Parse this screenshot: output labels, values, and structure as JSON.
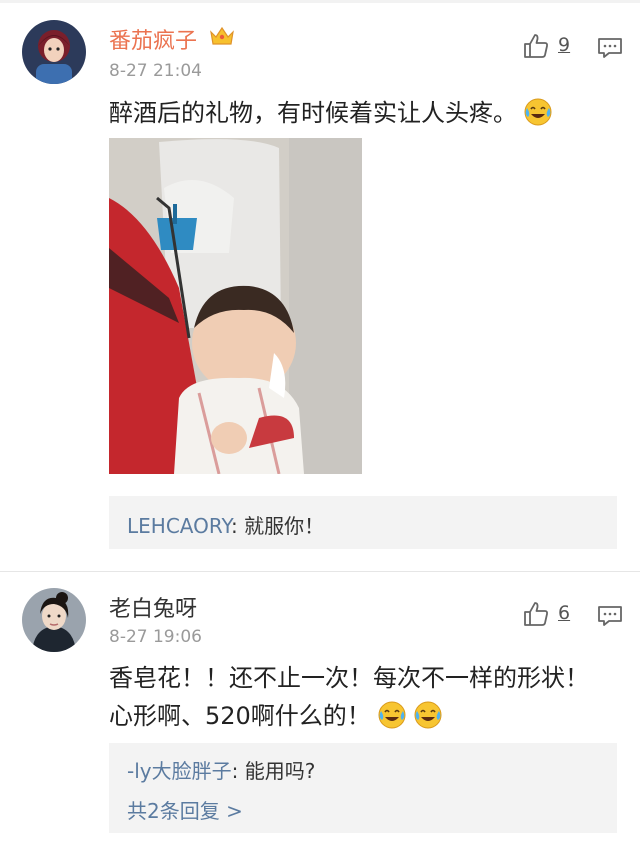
{
  "comments": [
    {
      "username": "番茄疯子",
      "time": "8-27 21:04",
      "likes": "9",
      "text": "醉酒后的礼物，有时候着实让人头疼。",
      "reply": {
        "user": "LEHCAORY",
        "sep": ": ",
        "text": "就服你！"
      }
    },
    {
      "username": "老白兔呀",
      "time": "8-27 19:06",
      "likes": "6",
      "text": "香皂花！！还不止一次！每次不一样的形状！心形啊、520啊什么的！",
      "reply": {
        "user": "-ly大脸胖子",
        "sep": ": ",
        "text": "能用吗?"
      },
      "more_replies": "共2条回复 >"
    }
  ],
  "colors": {
    "vip_name": "#eb7350",
    "link": "#5b7ba0",
    "reply_bg": "#f3f3f3"
  },
  "icons": [
    "crown-icon",
    "like-icon",
    "reply-icon",
    "laugh-cry-emoji"
  ]
}
